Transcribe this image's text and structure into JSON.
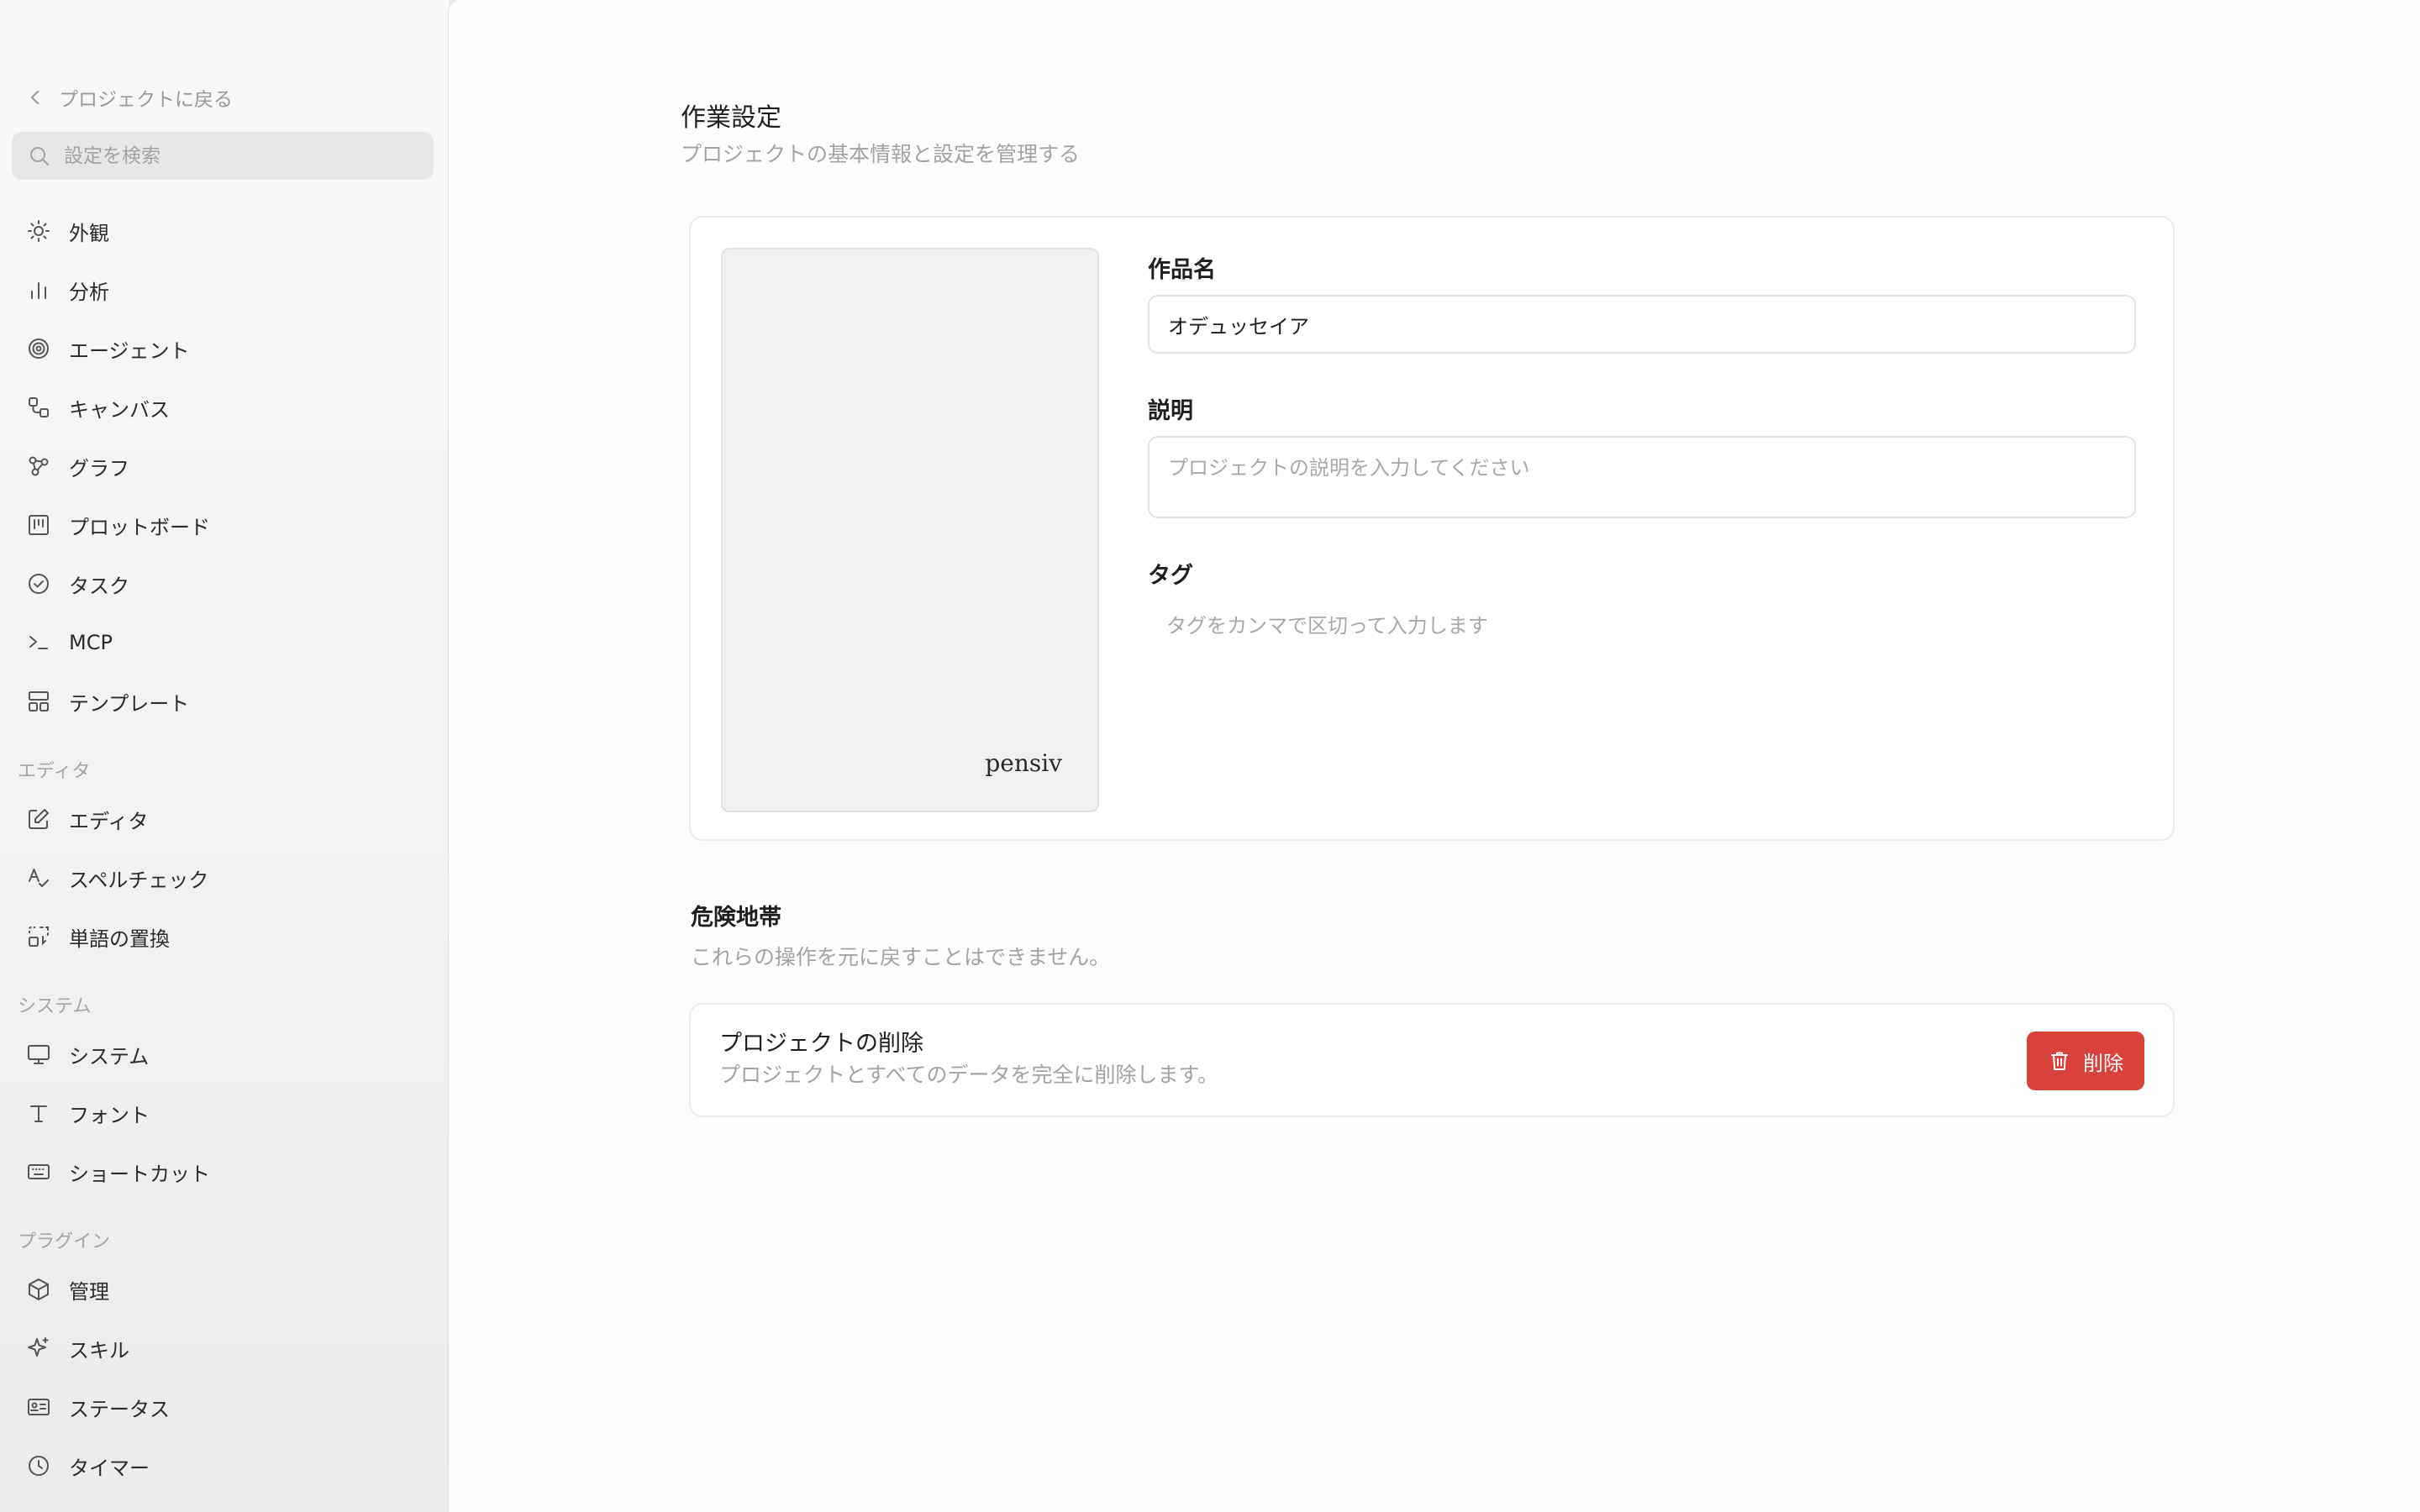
{
  "sidebar": {
    "back_label": "プロジェクトに戻る",
    "search_placeholder": "設定を検索",
    "items": [
      {
        "label": "外観",
        "icon": "sun-icon"
      },
      {
        "label": "分析",
        "icon": "bar-chart-icon"
      },
      {
        "label": "エージェント",
        "icon": "spiral-icon"
      },
      {
        "label": "キャンバス",
        "icon": "shapes-icon"
      },
      {
        "label": "グラフ",
        "icon": "graph-nodes-icon"
      },
      {
        "label": "プロットボード",
        "icon": "kanban-icon"
      },
      {
        "label": "タスク",
        "icon": "check-circle-icon"
      },
      {
        "label": "MCP",
        "icon": "terminal-icon"
      },
      {
        "label": "テンプレート",
        "icon": "layout-icon"
      }
    ],
    "sections": {
      "editor": {
        "label": "エディタ",
        "items": [
          {
            "label": "エディタ",
            "icon": "edit-icon"
          },
          {
            "label": "スペルチェック",
            "icon": "spellcheck-icon"
          },
          {
            "label": "単語の置換",
            "icon": "replace-icon"
          }
        ]
      },
      "system": {
        "label": "システム",
        "items": [
          {
            "label": "システム",
            "icon": "monitor-icon"
          },
          {
            "label": "フォント",
            "icon": "type-icon"
          },
          {
            "label": "ショートカット",
            "icon": "keyboard-icon"
          }
        ]
      },
      "plugins": {
        "label": "プラグイン",
        "items": [
          {
            "label": "管理",
            "icon": "package-icon"
          },
          {
            "label": "スキル",
            "icon": "sparkles-icon"
          },
          {
            "label": "ステータス",
            "icon": "id-card-icon"
          },
          {
            "label": "タイマー",
            "icon": "clock-icon"
          }
        ]
      }
    }
  },
  "main": {
    "title": "作業設定",
    "subtitle": "プロジェクトの基本情報と設定を管理する",
    "cover_brand": "pensiv",
    "fields": {
      "name_label": "作品名",
      "name_value": "オデュッセイア",
      "description_label": "説明",
      "description_placeholder": "プロジェクトの説明を入力してください",
      "tags_label": "タグ",
      "tags_placeholder": "タグをカンマで区切って入力します"
    },
    "danger": {
      "title": "危険地帯",
      "description": "これらの操作を元に戻すことはできません。",
      "delete_title": "プロジェクトの削除",
      "delete_description": "プロジェクトとすべてのデータを完全に削除します。",
      "delete_button": "削除",
      "button_color": "#d9413b"
    }
  }
}
